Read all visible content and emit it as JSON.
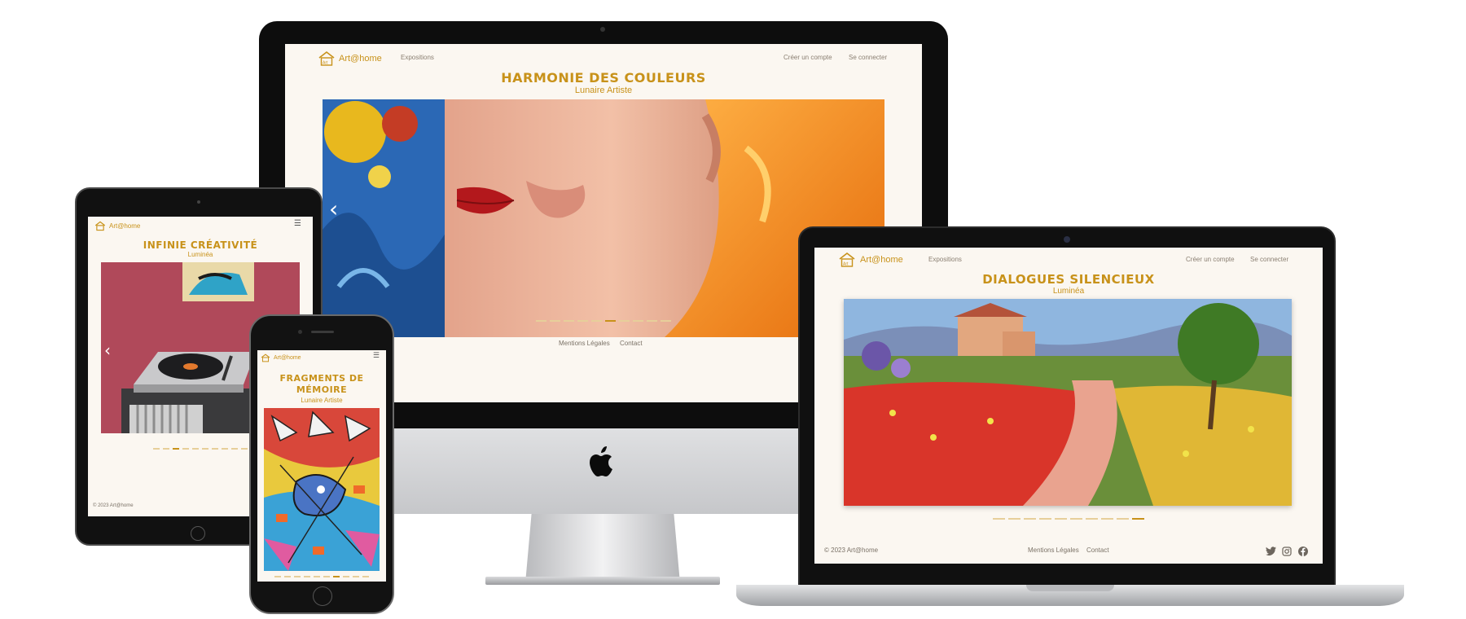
{
  "site": {
    "logo_text": "Art@home",
    "nav_expositions": "Expositions",
    "nav_create_account": "Créer un compte",
    "nav_login": "Se connecter",
    "footer_legal": "Mentions Légales",
    "footer_contact": "Contact",
    "footer_copyright": "© 2023 Art@home",
    "menu_glyph": "☰",
    "prev_glyph": "‹"
  },
  "desktop": {
    "title": "HARMONIE DES COULEURS",
    "artist": "Lunaire Artiste",
    "active_slide": 6,
    "slide_count": 10
  },
  "laptop": {
    "title": "DIALOGUES SILENCIEUX",
    "artist": "Luminéa",
    "active_slide": 10,
    "slide_count": 10,
    "social_icons": [
      "twitter-icon",
      "instagram-icon",
      "facebook-icon"
    ]
  },
  "tablet": {
    "title": "INFINIE CRÉATIVITÉ",
    "artist": "Luminéa",
    "active_slide": 3,
    "slide_count": 10
  },
  "phone": {
    "title_line1": "FRAGMENTS DE",
    "title_line2": "MÉMOIRE",
    "artist": "Lunaire Artiste",
    "active_slide": 7,
    "slide_count": 10
  },
  "colors": {
    "accent": "#c8921a",
    "page_bg": "#fbf7f1",
    "dot_inactive": "#e7cf9a"
  }
}
